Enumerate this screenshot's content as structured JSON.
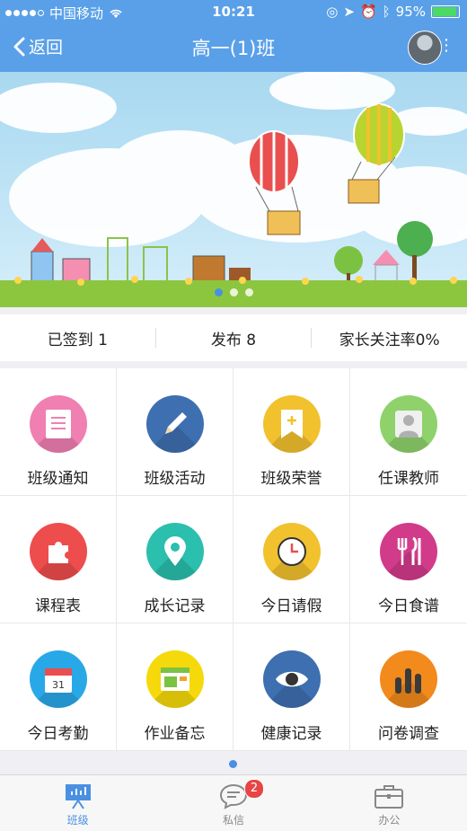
{
  "status_bar": {
    "carrier": "中国移动",
    "time": "10:21",
    "battery_percent": "95%",
    "battery_level": 0.95
  },
  "navbar": {
    "back_label": "返回",
    "title": "高一(1)班"
  },
  "banner": {
    "slide_count": 3,
    "active_slide": 1
  },
  "stats": [
    {
      "label": "已签到 1"
    },
    {
      "label": "发布 8"
    },
    {
      "label": "家长关注率0%"
    }
  ],
  "grid": {
    "items": [
      {
        "label": "班级通知",
        "icon": "notice-icon",
        "color": "#f07fb2"
      },
      {
        "label": "班级活动",
        "icon": "pencil-icon",
        "color": "#3e6fb0"
      },
      {
        "label": "班级荣誉",
        "icon": "bookmark-icon",
        "color": "#f2c12e"
      },
      {
        "label": "任课教师",
        "icon": "person-icon",
        "color": "#8fd16b"
      },
      {
        "label": "课程表",
        "icon": "puzzle-icon",
        "color": "#ee4d4d"
      },
      {
        "label": "成长记录",
        "icon": "location-pin-icon",
        "color": "#2bbfae"
      },
      {
        "label": "今日请假",
        "icon": "clock-icon",
        "color": "#f2c12e"
      },
      {
        "label": "今日食谱",
        "icon": "utensils-icon",
        "color": "#d23b8a"
      },
      {
        "label": "今日考勤",
        "icon": "calendar-icon",
        "color": "#29a8e8"
      },
      {
        "label": "作业备忘",
        "icon": "notes-icon",
        "color": "#f5d90a"
      },
      {
        "label": "健康记录",
        "icon": "eye-icon",
        "color": "#3e6fb0"
      },
      {
        "label": "问卷调查",
        "icon": "bar-chart-icon",
        "color": "#f28a1c"
      }
    ]
  },
  "tabbar": {
    "tabs": [
      {
        "label": "班级",
        "icon": "class-board-icon",
        "active": true
      },
      {
        "label": "私信",
        "icon": "chat-icon",
        "badge": "2"
      },
      {
        "label": "办公",
        "icon": "briefcase-icon"
      }
    ]
  },
  "colors": {
    "nav_bg": "#5aa0e8",
    "accent": "#4a90e2",
    "badge": "#e84545"
  }
}
